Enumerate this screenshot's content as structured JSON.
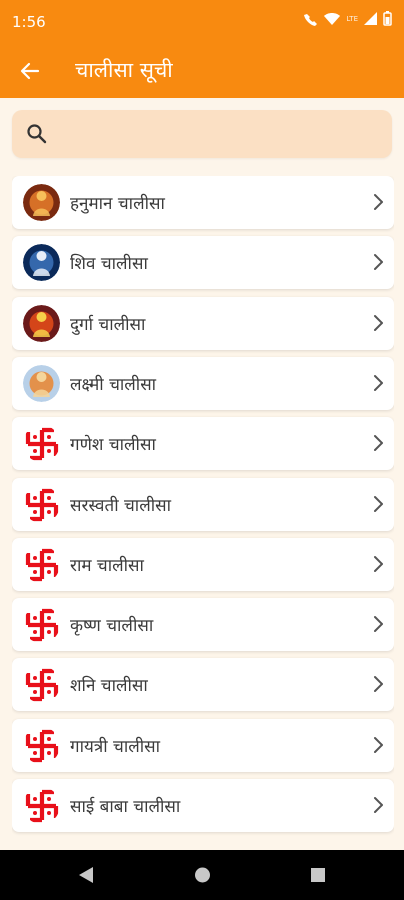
{
  "status_bar": {
    "time": "1:56",
    "network": "LTE"
  },
  "app_bar": {
    "title": "चालीसा सूची"
  },
  "search": {
    "placeholder": "",
    "value": ""
  },
  "chalisa_list": [
    {
      "label": "हनुमान चालीसा",
      "icon": "hanuman-portrait"
    },
    {
      "label": "शिव चालीसा",
      "icon": "shiva-portrait"
    },
    {
      "label": "दुर्गा चालीसा",
      "icon": "durga-portrait"
    },
    {
      "label": "लक्ष्मी चालीसा",
      "icon": "lakshmi-portrait"
    },
    {
      "label": "गणेश चालीसा",
      "icon": "swastika"
    },
    {
      "label": "सरस्वती चालीसा",
      "icon": "swastika"
    },
    {
      "label": "राम चालीसा",
      "icon": "swastika"
    },
    {
      "label": "कृष्ण चालीसा",
      "icon": "swastika"
    },
    {
      "label": "शनि चालीसा",
      "icon": "swastika"
    },
    {
      "label": "गायत्री चालीसा",
      "icon": "swastika"
    },
    {
      "label": "साई बाबा चालीसा",
      "icon": "swastika"
    }
  ],
  "colors": {
    "accent": "#f88a10",
    "search_bg": "#fbe0c4",
    "swastika": "#e8101a",
    "page_bg": "#fdf5ea"
  }
}
